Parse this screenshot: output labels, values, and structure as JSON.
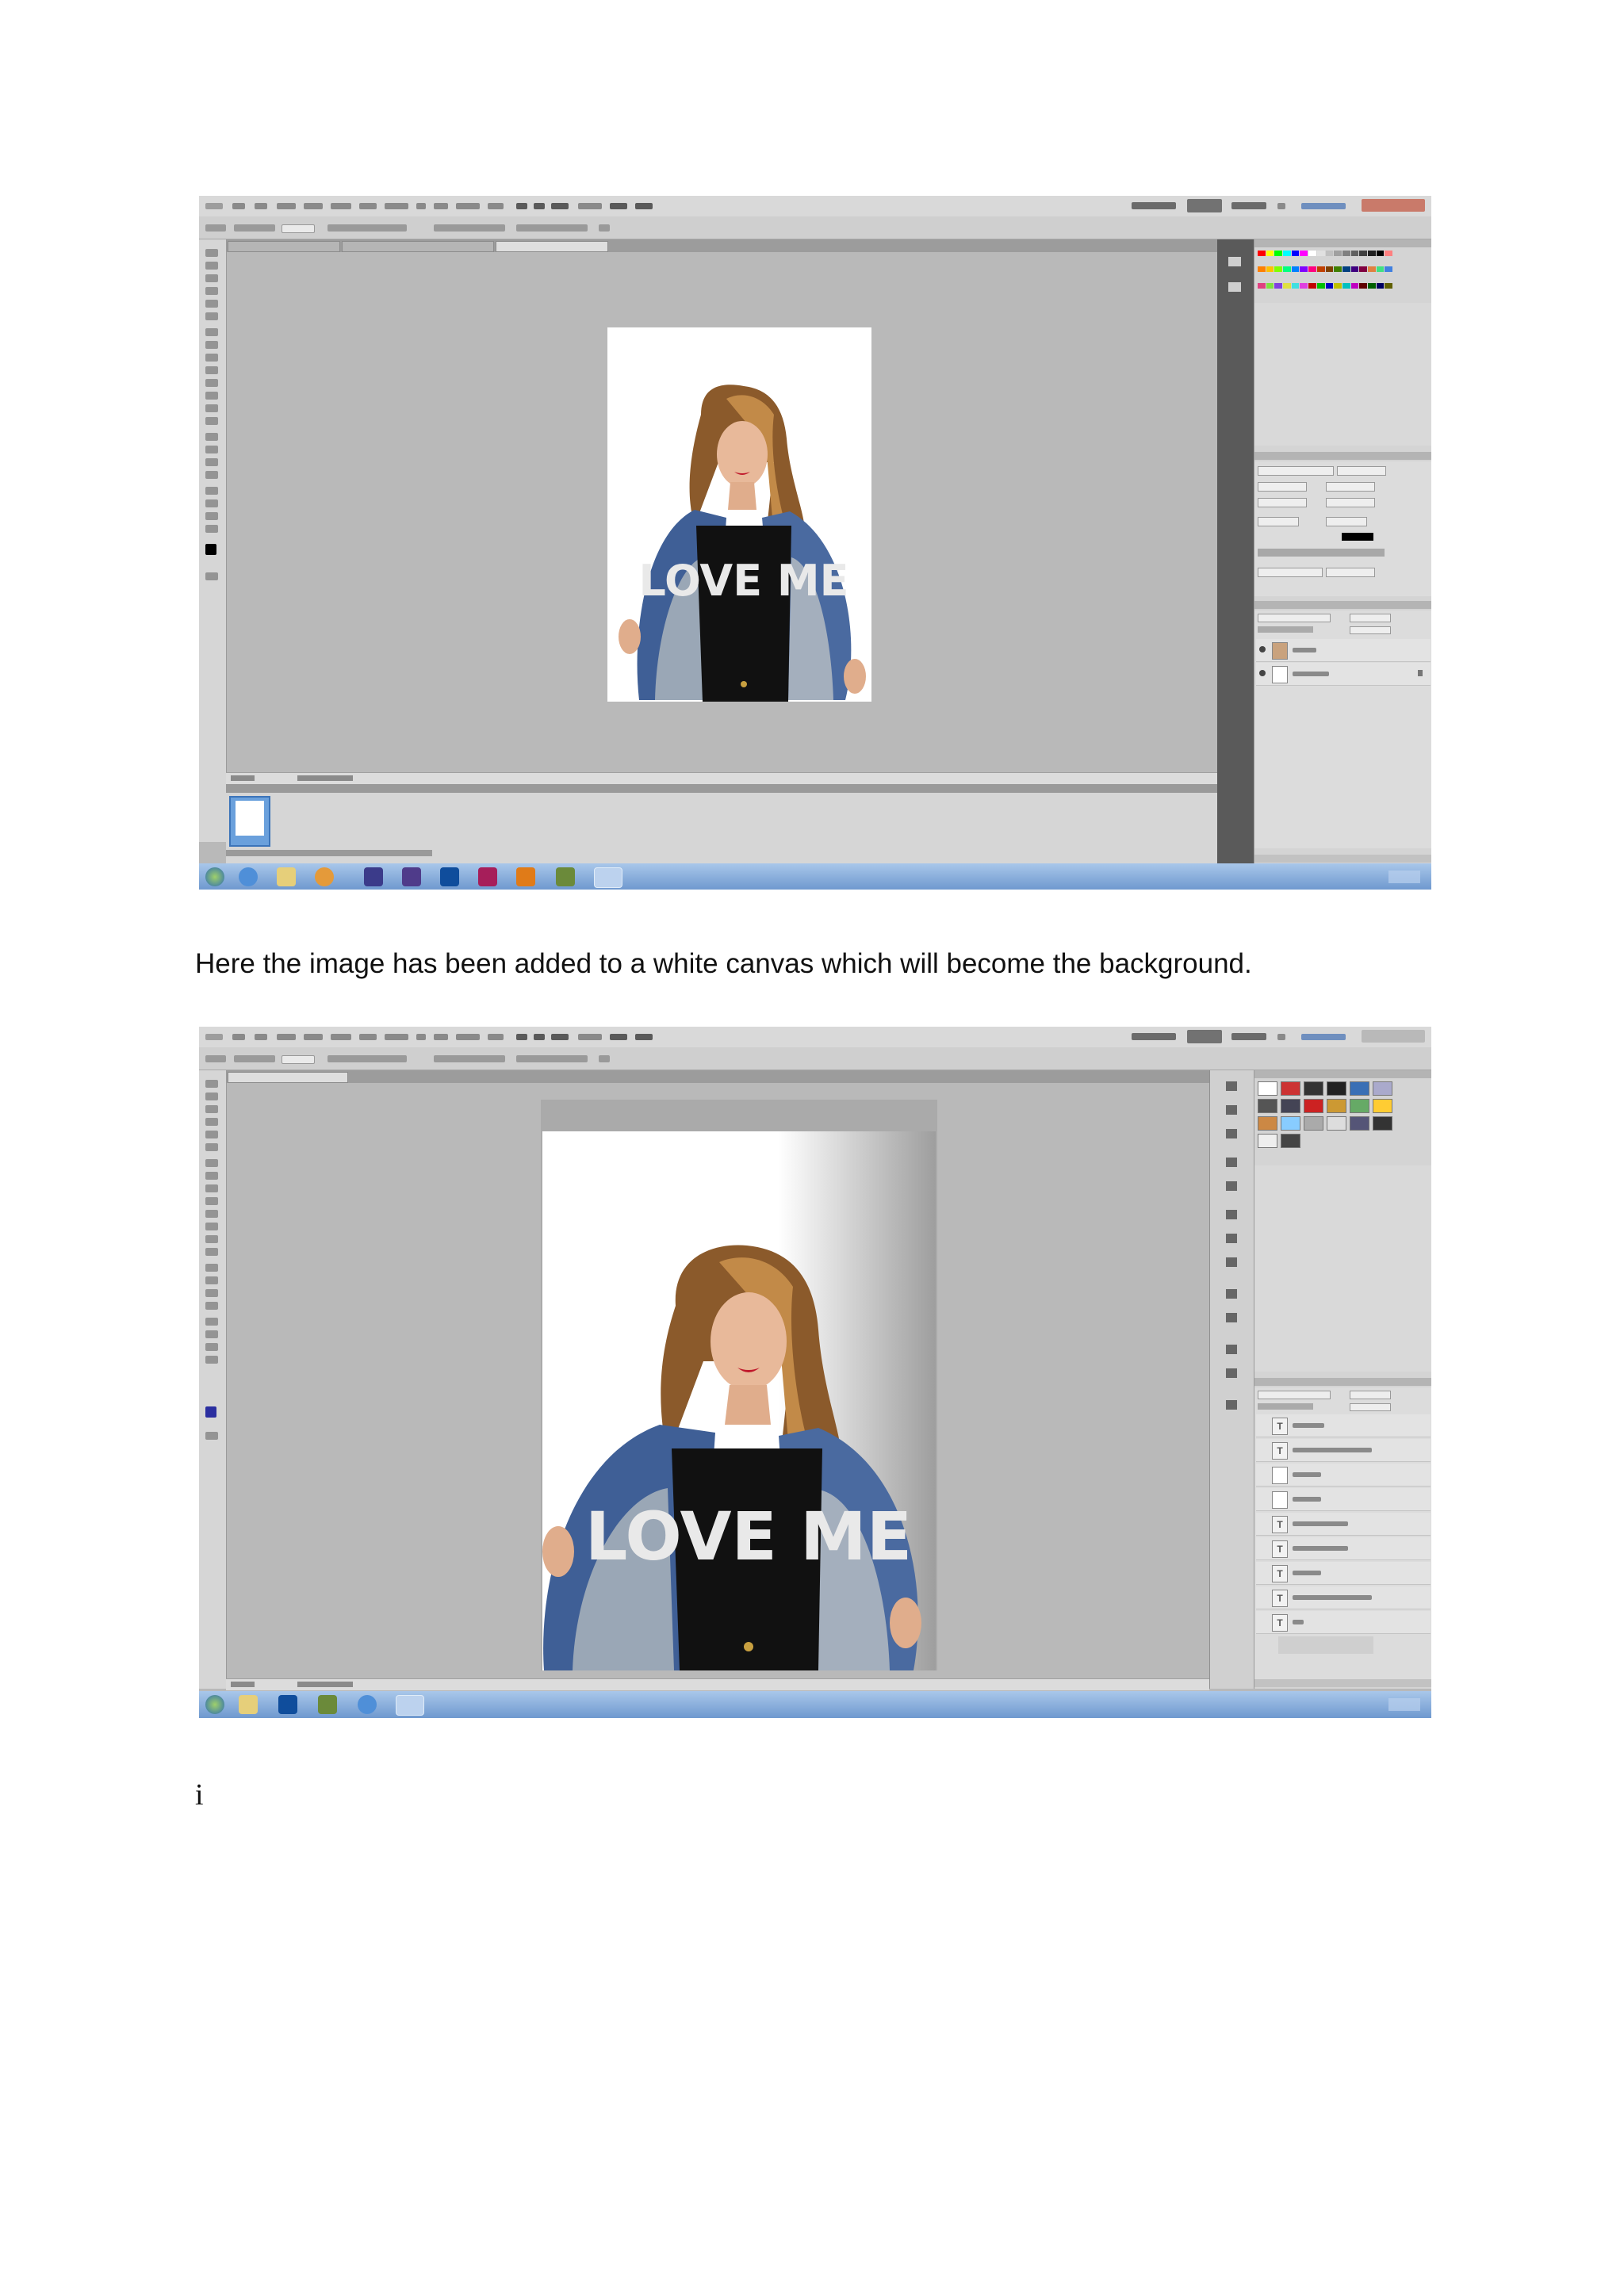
{
  "document": {
    "caption": "Here the image has been added to a white canvas which will become the background.",
    "footer_mark": "i"
  },
  "screenshot_1": {
    "description_role": "Photoshop CS5 workspace, small portrait canvas",
    "shirt_text": "LOVE ME",
    "layers": [
      "Layer 1",
      "Background"
    ]
  },
  "screenshot_2": {
    "description_role": "Photoshop CS5 workspace, enlarged portrait with gradient background",
    "shirt_text": "LOVE ME"
  },
  "colors": {
    "workspace_gray": "#b9b9b9",
    "panel_gray": "#d4d4d4",
    "taskbar_blue": "#8ab0de",
    "canvas_white": "#ffffff"
  }
}
